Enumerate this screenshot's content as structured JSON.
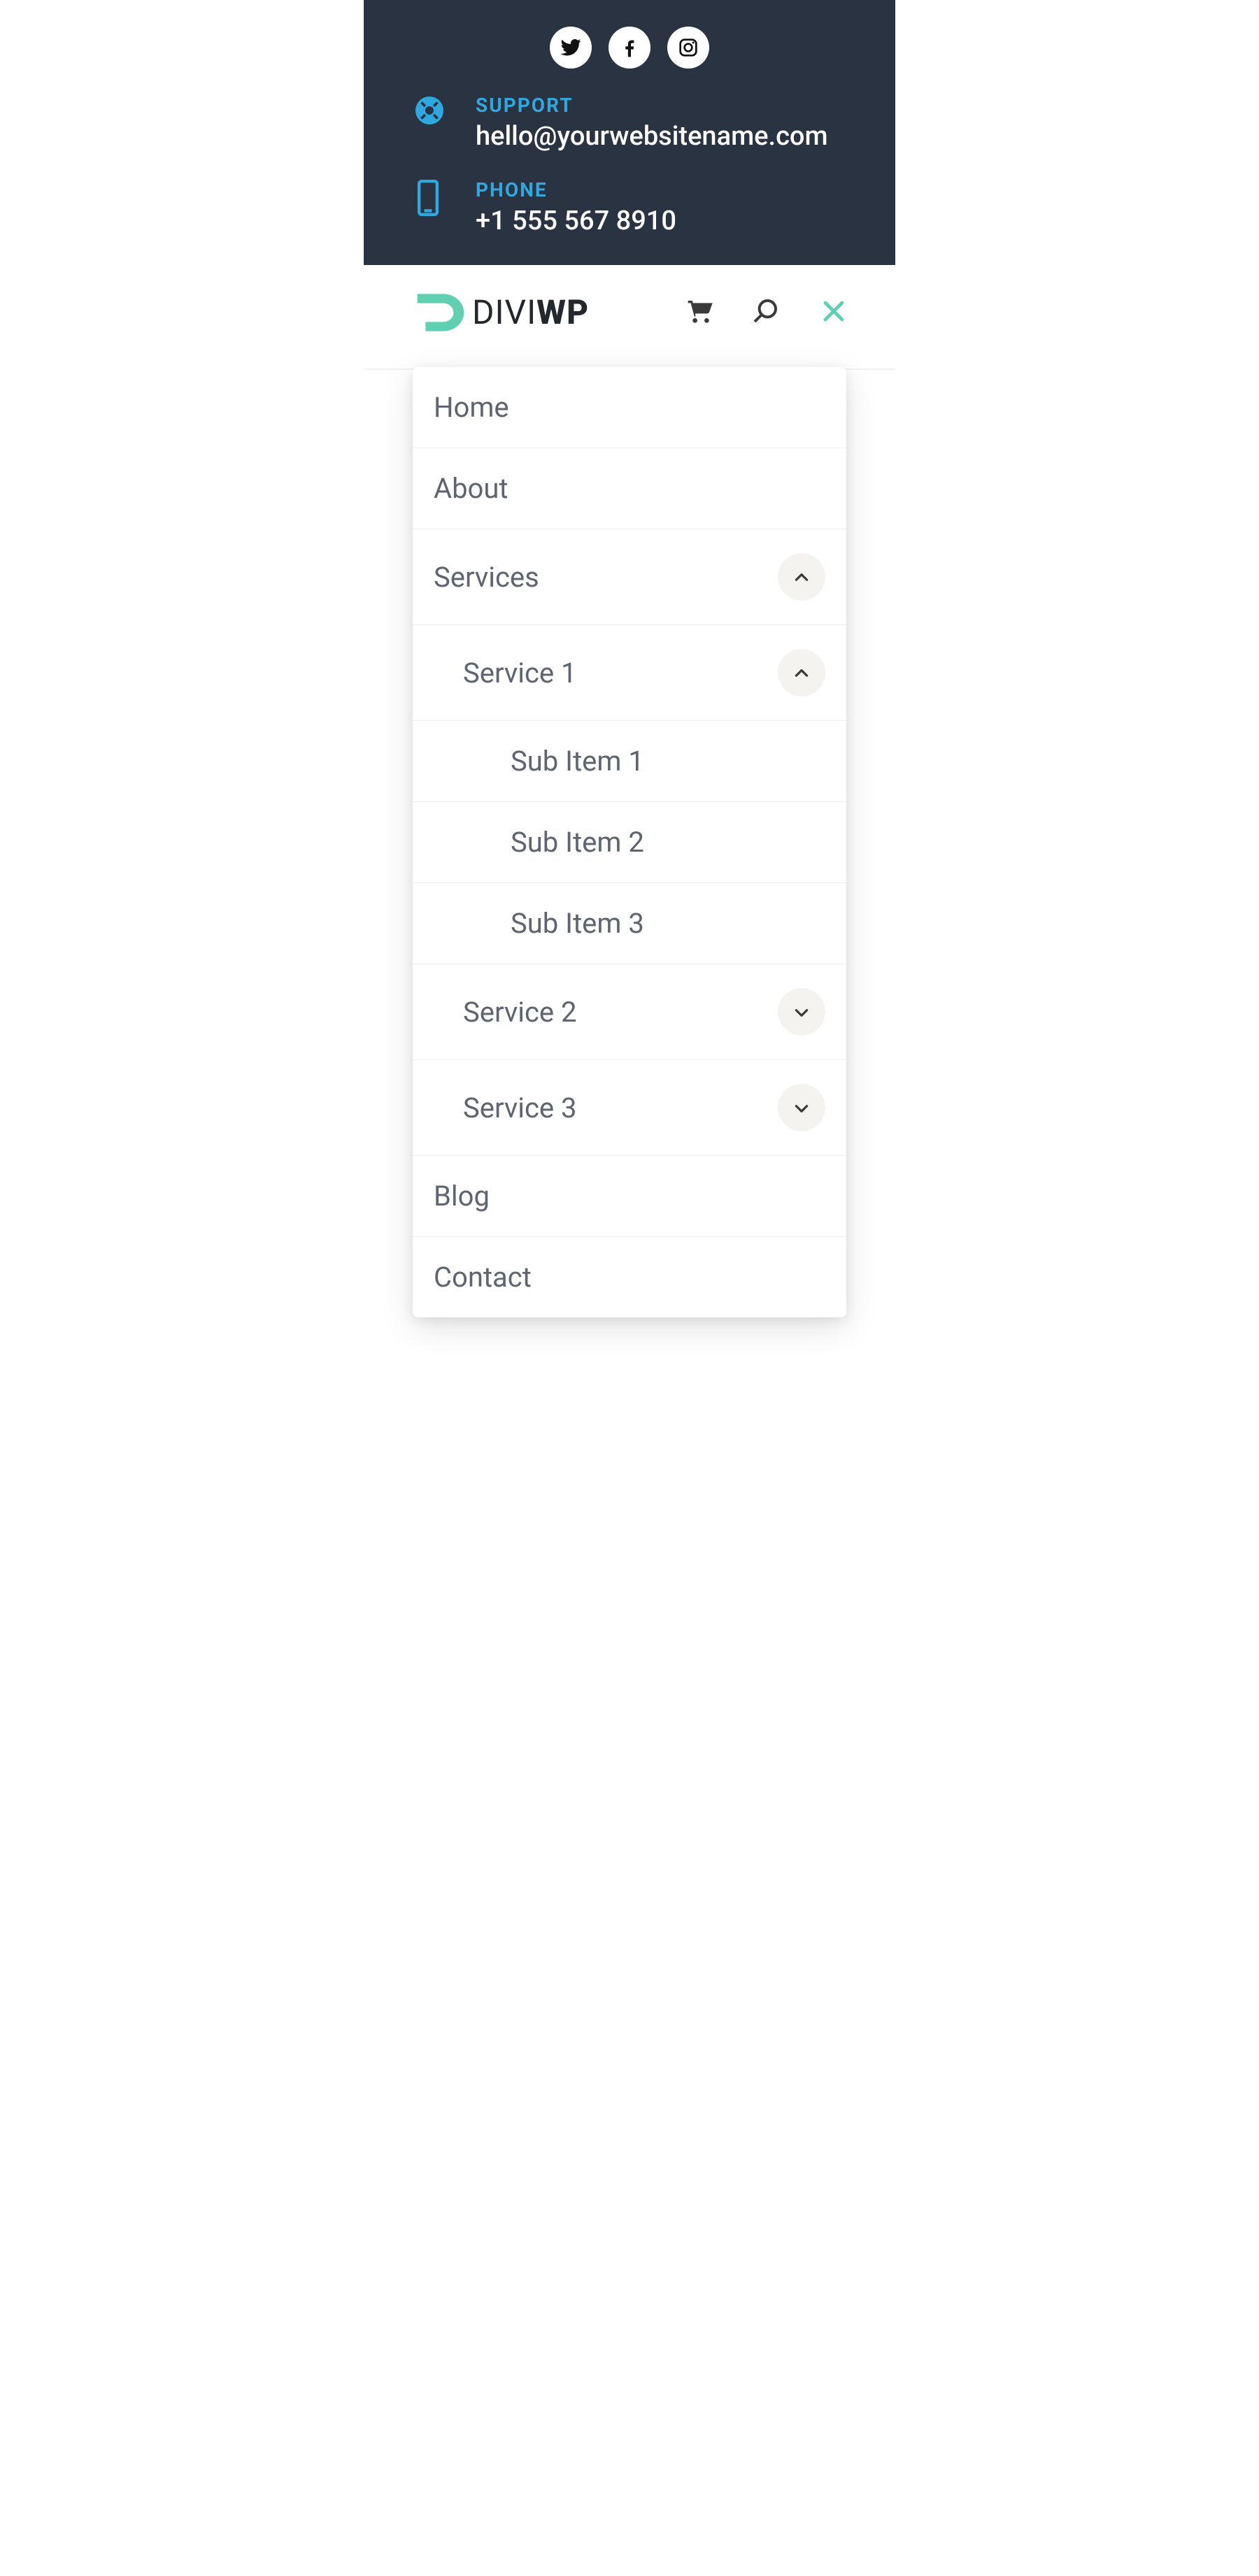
{
  "header": {
    "support_label": "SUPPORT",
    "support_value": "hello@yourwebsitename.com",
    "phone_label": "PHONE",
    "phone_value": "+1 555 567 8910"
  },
  "brand": {
    "name_light": "DIVI",
    "name_bold": "WP"
  },
  "menu": {
    "home": "Home",
    "about": "About",
    "services": "Services",
    "service1": "Service 1",
    "sub1": "Sub Item 1",
    "sub2": "Sub Item 2",
    "sub3": "Sub Item 3",
    "service2": "Service 2",
    "service3": "Service 3",
    "blog": "Blog",
    "contact": "Contact"
  }
}
